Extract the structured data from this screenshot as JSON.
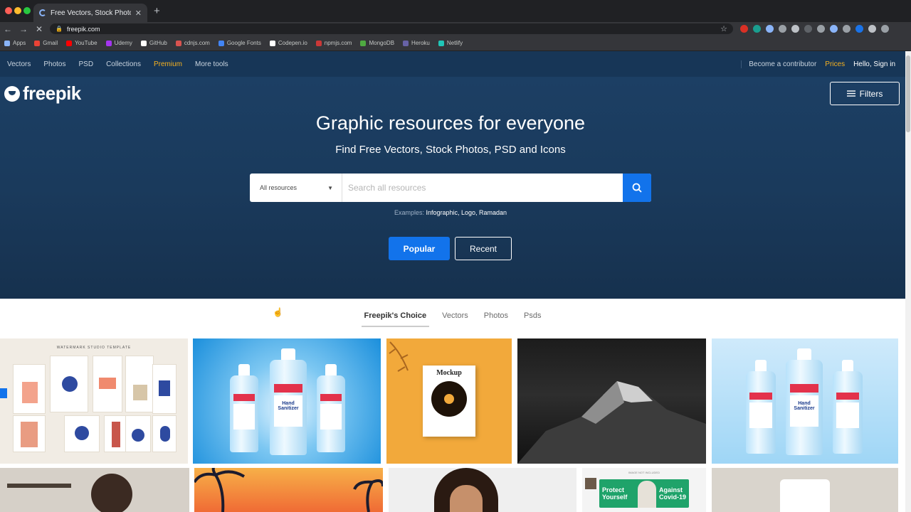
{
  "browser": {
    "tab_title": "Free Vectors, Stock Photos & Fr",
    "url": "freepik.com",
    "bookmarks": [
      {
        "label": "Apps",
        "color": "#8ab4f8"
      },
      {
        "label": "Gmail",
        "color": "#ea4335"
      },
      {
        "label": "YouTube",
        "color": "#ff0000"
      },
      {
        "label": "Udemy",
        "color": "#a435f0"
      },
      {
        "label": "GitHub",
        "color": "#ffffff"
      },
      {
        "label": "cdnjs.com",
        "color": "#d9534f"
      },
      {
        "label": "Google Fonts",
        "color": "#4285f4"
      },
      {
        "label": "Codepen.io",
        "color": "#ffffff"
      },
      {
        "label": "npmjs.com",
        "color": "#cb3837"
      },
      {
        "label": "MongoDB",
        "color": "#4faa41"
      },
      {
        "label": "Heroku",
        "color": "#6762a6"
      },
      {
        "label": "Netlify",
        "color": "#20c6b7"
      }
    ]
  },
  "topnav": {
    "items": [
      "Vectors",
      "Photos",
      "PSD",
      "Collections",
      "Premium",
      "More tools"
    ],
    "contributor": "Become a contributor",
    "pricing": "Prices",
    "signin": "Hello, Sign in"
  },
  "hero": {
    "logo": "freepik",
    "filters": "Filters",
    "title": "Graphic resources for everyone",
    "subtitle": "Find Free Vectors, Stock Photos, PSD and Icons",
    "search": {
      "category": "All resources",
      "placeholder": "Search all resources"
    },
    "examples_label": "Examples:",
    "examples": "Infographic, Logo, Ramadan",
    "popular": "Popular",
    "recent": "Recent"
  },
  "tabs": [
    "Freepik's Choice",
    "Vectors",
    "Photos",
    "Psds"
  ],
  "thumbnails": {
    "t1_heading": "WATERMARK STUDIO TEMPLATE",
    "t2_label": "Hand Sanitizer",
    "t3_label": "Mockup",
    "t5_label": "Hand Sanitizer",
    "t9_left": "Protect Yourself",
    "t9_right": "Against Covid-19",
    "t9_top": "IMAGE NOT INCLUDED"
  },
  "colors": {
    "hero_bg": "#1c3f64",
    "accent_blue": "#1273eb",
    "premium": "#f5b120"
  }
}
